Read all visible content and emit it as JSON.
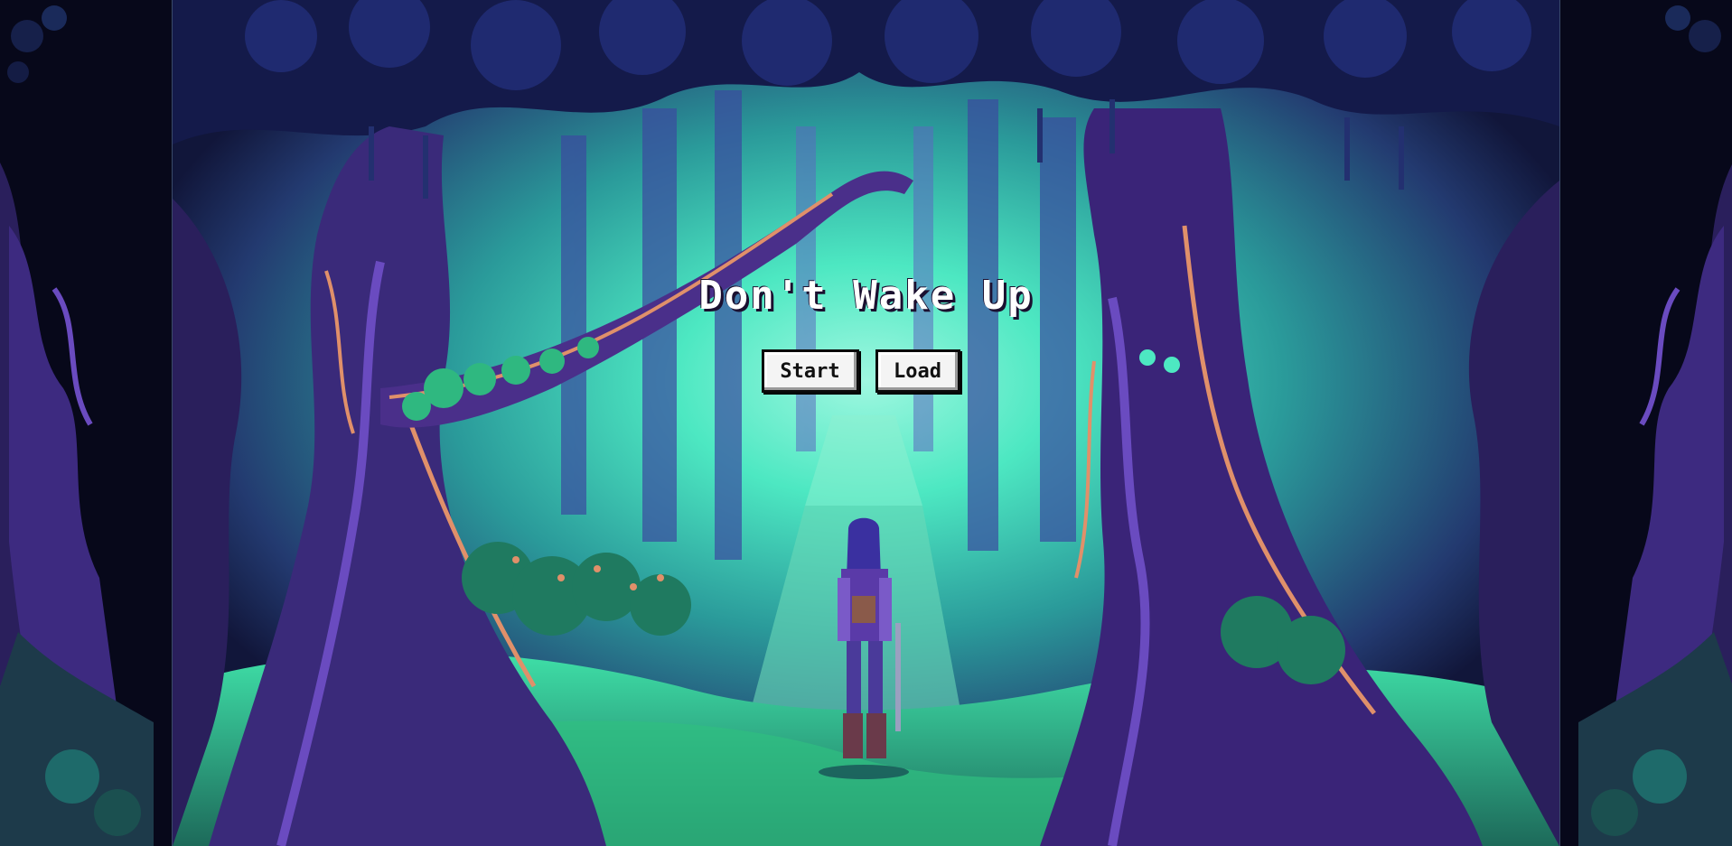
{
  "game": {
    "title": "Don't Wake Up"
  },
  "menu": {
    "start_label": "Start",
    "load_label": "Load"
  },
  "palette": {
    "background": "#05060c",
    "glow": "#4de8c2",
    "tree_purple": "#4a2f8a",
    "bark_highlight": "#e0906a",
    "grass": "#3fe08a"
  }
}
